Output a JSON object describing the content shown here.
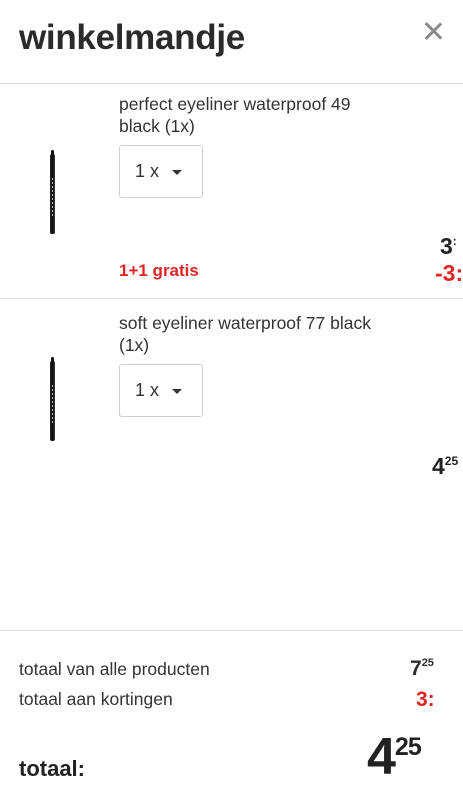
{
  "header": {
    "title": "winkelmandje",
    "close_icon": "close-icon"
  },
  "items": [
    {
      "name": "perfect eyeliner waterproof 49 black (1x)",
      "quantity": "1 x",
      "price_main": "3",
      "price_sup": ":",
      "promo": "1+1 gratis",
      "discount": "-3:",
      "image": "eyeliner-pencil-icon"
    },
    {
      "name": "soft eyeliner waterproof 77 black (1x)",
      "quantity": "1 x",
      "price_main": "4",
      "price_sup": "25",
      "image": "eyeliner-pencil-icon"
    }
  ],
  "summary": {
    "total_products_label": "totaal van alle producten",
    "total_products_main": "7",
    "total_products_sup": "25",
    "total_discounts_label": "totaal aan kortingen",
    "total_discounts_value": "3:",
    "total_label": "totaal:",
    "total_main": "4",
    "total_sup": "25"
  },
  "colors": {
    "discount": "#e02525",
    "text": "#333333",
    "border": "#dcdcdc"
  }
}
